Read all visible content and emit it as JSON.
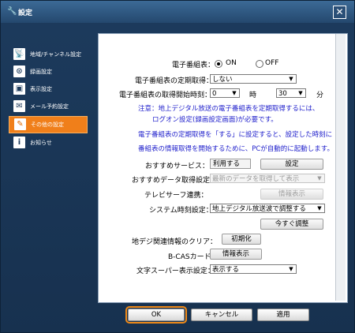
{
  "window": {
    "title": "設定",
    "title_icon": "wrench-icon",
    "close_label": "✕"
  },
  "sidebar": {
    "items": [
      {
        "label": "地域/チャンネル設定",
        "icon": "antenna-icon",
        "glyph": "📡",
        "active": false
      },
      {
        "label": "録画設定",
        "icon": "record-icon",
        "glyph": "⊙",
        "active": false
      },
      {
        "label": "表示設定",
        "icon": "display-icon",
        "glyph": "▣",
        "active": false
      },
      {
        "label": "メール予約設定",
        "icon": "mail-icon",
        "glyph": "✉",
        "active": false
      },
      {
        "label": "その他の設定",
        "icon": "pen-icon",
        "glyph": "✎",
        "active": true
      },
      {
        "label": "お知らせ",
        "icon": "info-icon",
        "glyph": "i",
        "active": false
      }
    ]
  },
  "settings": {
    "epg_label": "電子番組表：",
    "epg_on": "ON",
    "epg_off": "OFF",
    "periodic_label": "電子番組表の定期取得：",
    "periodic_value": "しない",
    "start_time_label": "電子番組表の取得開始時刻：",
    "hour_value": "0",
    "hour_unit": "時",
    "minute_value": "30",
    "minute_unit": "分",
    "note1_line1": "注意：地上デジタル放送の電子番組表を定期取得するには、",
    "note1_line2": "ログオン設定(録画設定画面)が必要です。",
    "note2_line1": "電子番組表の定期取得を「する」に設定すると、設定した時刻に",
    "note2_line2": "番組表の情報取得を開始するために、PCが自動的に起動します。",
    "recommend_label": "おすすめサービス：",
    "recommend_value": "利用する",
    "recommend_btn": "設定",
    "recdata_label": "おすすめデータ取得設定：",
    "recdata_value": "最新のデータを取得して表示",
    "tvsurf_label": "テレビサーフ連携：",
    "tvsurf_btn": "情報表示",
    "clock_label": "システム時刻設定：",
    "clock_value": "地上デジタル放送波で調整する",
    "adjust_btn": "今すぐ調整",
    "clear_label": "地デジ関連情報のクリア：",
    "clear_btn": "初期化",
    "bcas_label": "B-CASカード：",
    "bcas_btn": "情報表示",
    "super_label": "文字スーパー表示設定：",
    "super_value": "表示する"
  },
  "footer": {
    "ok": "OK",
    "cancel": "キャンセル",
    "apply": "適用"
  }
}
